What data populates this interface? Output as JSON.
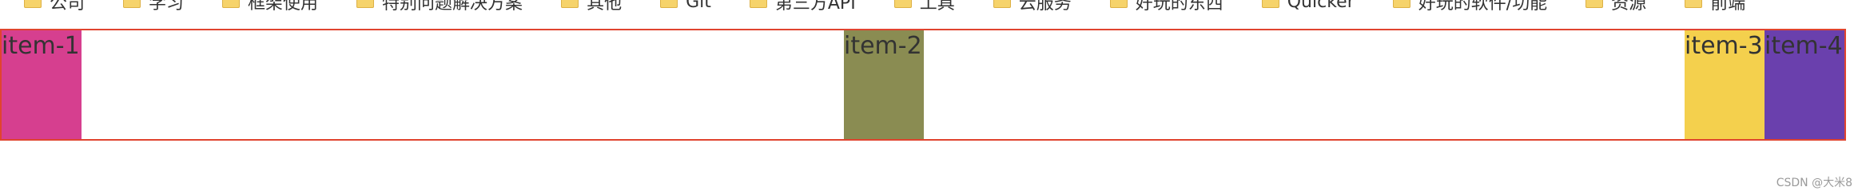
{
  "bookmarks": [
    {
      "label": "公司",
      "icon": "folder-icon"
    },
    {
      "label": "学习",
      "icon": "folder-icon"
    },
    {
      "label": "框架使用",
      "icon": "folder-icon"
    },
    {
      "label": "特别问题解决方案",
      "icon": "folder-icon"
    },
    {
      "label": "其他",
      "icon": "folder-icon"
    },
    {
      "label": "Git",
      "icon": "folder-icon"
    },
    {
      "label": "第三方API",
      "icon": "folder-icon"
    },
    {
      "label": "工具",
      "icon": "folder-icon"
    },
    {
      "label": "云服务",
      "icon": "folder-icon"
    },
    {
      "label": "好玩的东西",
      "icon": "folder-icon"
    },
    {
      "label": "Quicker",
      "icon": "folder-icon"
    },
    {
      "label": "好玩的软件/功能",
      "icon": "folder-icon"
    },
    {
      "label": "资源",
      "icon": "folder-icon"
    },
    {
      "label": "前端",
      "icon": "folder-icon"
    }
  ],
  "flex_demo": {
    "border_color": "#e0442f",
    "items": [
      {
        "label": "item-1",
        "color": "#d63f8f"
      },
      {
        "label": "item-2",
        "color": "#8a8c52"
      },
      {
        "label": "item-3",
        "color": "#f4d04d"
      },
      {
        "label": "item-4",
        "color": "#6a40ad"
      }
    ]
  },
  "watermark": "CSDN @大米8"
}
